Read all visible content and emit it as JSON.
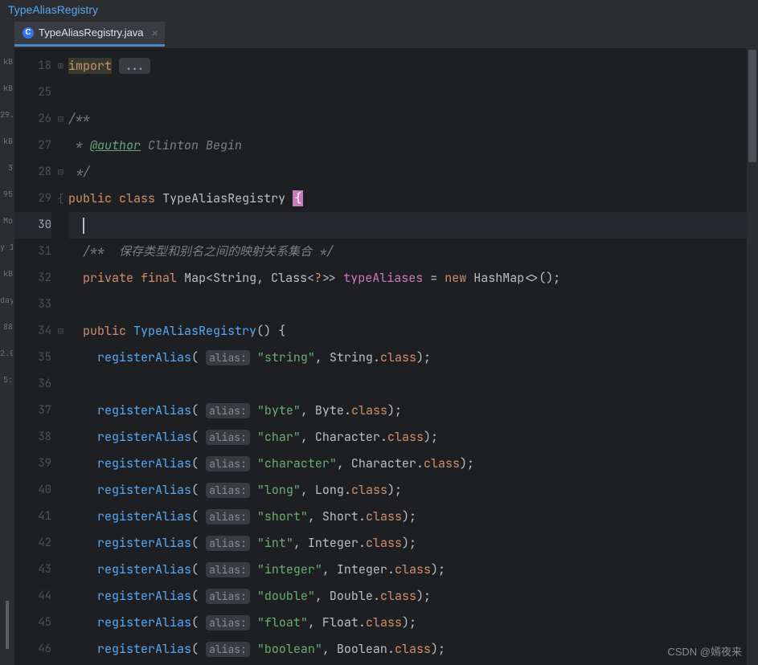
{
  "breadcrumb": "TypeAliasRegistry",
  "tab": {
    "icon_letter": "C",
    "filename": "TypeAliasRegistry.java",
    "close": "×"
  },
  "sidebar_fragments": [
    "kB",
    "kB",
    "29.",
    "kB",
    "3",
    "95",
    "",
    "Mo",
    "",
    "y 1",
    "kB",
    "day",
    "88",
    "2.0",
    "",
    "5:",
    "",
    "",
    "",
    "",
    "",
    "",
    ""
  ],
  "line_numbers": [
    "18",
    "25",
    "26",
    "27",
    "28",
    "29",
    "30",
    "31",
    "32",
    "33",
    "34",
    "35",
    "36",
    "37",
    "38",
    "39",
    "40",
    "41",
    "42",
    "43",
    "44",
    "45",
    "46"
  ],
  "code": {
    "l18": {
      "kw": "import",
      "fold": "..."
    },
    "l26": {
      "c": "/**"
    },
    "l27": {
      "pre": " * ",
      "tag": "@author",
      "rest": " Clinton Begin"
    },
    "l28": {
      "c": " */"
    },
    "l29": {
      "kw1": "public",
      "kw2": "class",
      "name": "TypeAliasRegistry",
      "brace": "{"
    },
    "l31": {
      "c": "/**  保存类型和别名之间的映射关系集合 */"
    },
    "l32": {
      "kw1": "private",
      "kw2": "final",
      "type1": "Map",
      "lt": "<",
      "type2": "String",
      "c1": ", ",
      "type3": "Class",
      "lt2": "<",
      "q": "?",
      "gt2": ">>",
      "field": "typeAliases",
      "eq": " = ",
      "kw3": "new",
      "type4": "HashMap",
      "diamond": "<>()",
      "semi": ";"
    },
    "l34": {
      "kw": "public",
      "name": "TypeAliasRegistry",
      "paren": "()",
      "brace": " {"
    },
    "hint": "alias:",
    "calls": [
      {
        "str": "\"string\"",
        "type": "String"
      },
      {
        "str": "\"byte\"",
        "type": "Byte"
      },
      {
        "str": "\"char\"",
        "type": "Character"
      },
      {
        "str": "\"character\"",
        "type": "Character"
      },
      {
        "str": "\"long\"",
        "type": "Long"
      },
      {
        "str": "\"short\"",
        "type": "Short"
      },
      {
        "str": "\"int\"",
        "type": "Integer"
      },
      {
        "str": "\"integer\"",
        "type": "Integer"
      },
      {
        "str": "\"double\"",
        "type": "Double"
      },
      {
        "str": "\"float\"",
        "type": "Float"
      },
      {
        "str": "\"boolean\"",
        "type": "Boolean"
      }
    ],
    "method": "registerAlias",
    "class_kw": "class"
  },
  "watermark": "CSDN @嫣夜来"
}
